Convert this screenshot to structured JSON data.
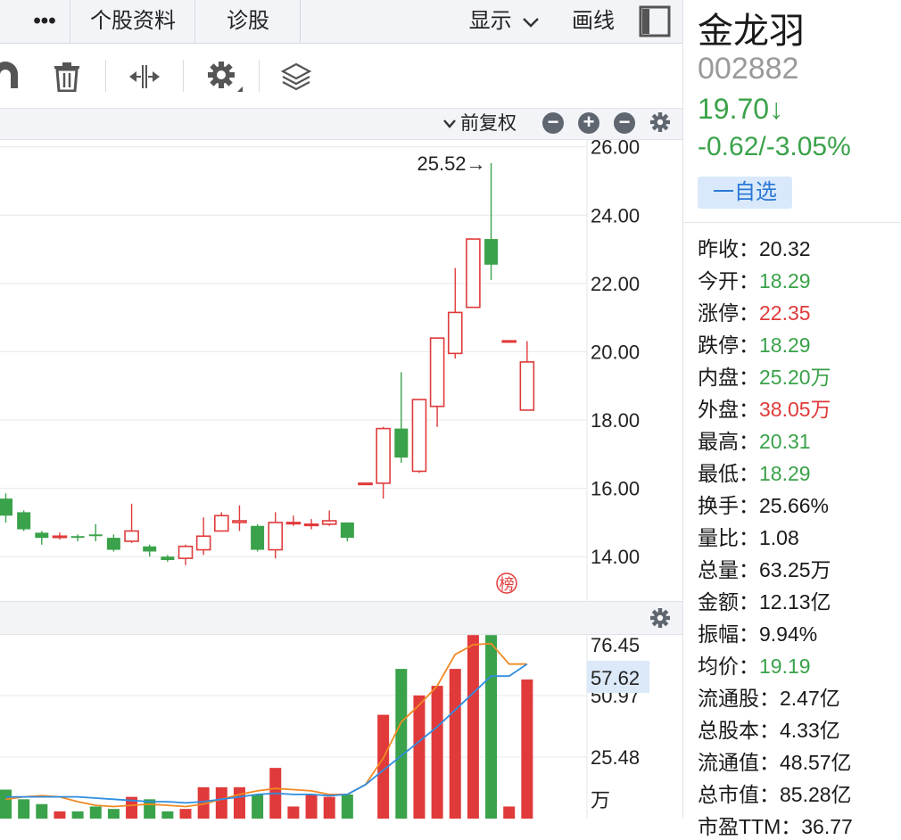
{
  "tabs": {
    "more_label": "•••",
    "profile_label": "个股资料",
    "diagnose_label": "诊股",
    "display_label": "显示",
    "draw_label": "画线"
  },
  "adjust": {
    "label": "前复权"
  },
  "stock": {
    "name": "金龙羽",
    "code": "002882",
    "price": "19.70↓",
    "change": "-0.62/-3.05%",
    "fav_label": "一自选"
  },
  "stats": [
    {
      "label": "昨收：",
      "value": "20.32",
      "color": "default"
    },
    {
      "label": "今开：",
      "value": "18.29",
      "color": "green"
    },
    {
      "label": "涨停：",
      "value": "22.35",
      "color": "red"
    },
    {
      "label": "跌停：",
      "value": "18.29",
      "color": "green"
    },
    {
      "label": "内盘：",
      "value": "25.20万",
      "color": "green"
    },
    {
      "label": "外盘：",
      "value": "38.05万",
      "color": "red"
    },
    {
      "label": "最高：",
      "value": "20.31",
      "color": "green"
    },
    {
      "label": "最低：",
      "value": "18.29",
      "color": "green"
    },
    {
      "label": "换手：",
      "value": "25.66%",
      "color": "default"
    },
    {
      "label": "量比：",
      "value": "1.08",
      "color": "default"
    },
    {
      "label": "总量：",
      "value": "63.25万",
      "color": "default"
    },
    {
      "label": "金额：",
      "value": "12.13亿",
      "color": "default"
    },
    {
      "label": "振幅：",
      "value": "9.94%",
      "color": "default"
    },
    {
      "label": "均价：",
      "value": "19.19",
      "color": "green"
    },
    {
      "label": "流通股：",
      "value": "2.47亿",
      "color": "default"
    },
    {
      "label": "总股本：",
      "value": "4.33亿",
      "color": "default"
    },
    {
      "label": "流通值：",
      "value": "48.57亿",
      "color": "default"
    },
    {
      "label": "总市值：",
      "value": "85.28亿",
      "color": "default"
    },
    {
      "label": "市盈TTM：",
      "value": "36.77",
      "color": "default"
    }
  ],
  "colors": {
    "up": "#e03a3a",
    "down": "#3aa24a",
    "ma_short": "#f08a24",
    "ma_long": "#2e8de0",
    "grid": "#e8e8e8",
    "panel_bg": "#f2f4f7"
  },
  "chart_data": [
    {
      "type": "candlestick",
      "yaxis": {
        "ticks": [
          "26.00",
          "24.00",
          "22.00",
          "20.00",
          "18.00",
          "16.00",
          "14.00"
        ],
        "ylim": [
          12.7,
          26.2
        ]
      },
      "max_annotation": "25.52→",
      "marker_text": "榜",
      "candles": [
        {
          "o": 15.7,
          "c": 15.2,
          "h": 15.85,
          "l": 15.0
        },
        {
          "o": 15.3,
          "c": 14.8,
          "h": 15.35,
          "l": 14.75
        },
        {
          "o": 14.7,
          "c": 14.55,
          "h": 14.75,
          "l": 14.35
        },
        {
          "o": 14.6,
          "c": 14.6,
          "h": 14.7,
          "l": 14.5
        },
        {
          "o": 14.6,
          "c": 14.55,
          "h": 14.65,
          "l": 14.45
        },
        {
          "o": 14.65,
          "c": 14.6,
          "h": 14.95,
          "l": 14.45
        },
        {
          "o": 14.55,
          "c": 14.2,
          "h": 14.65,
          "l": 14.15
        },
        {
          "o": 14.45,
          "c": 14.75,
          "h": 15.55,
          "l": 14.4
        },
        {
          "o": 14.3,
          "c": 14.15,
          "h": 14.35,
          "l": 14.0
        },
        {
          "o": 14.0,
          "c": 13.9,
          "h": 14.05,
          "l": 13.85
        },
        {
          "o": 13.95,
          "c": 14.3,
          "h": 14.35,
          "l": 13.75
        },
        {
          "o": 14.2,
          "c": 14.6,
          "h": 15.15,
          "l": 14.05
        },
        {
          "o": 14.75,
          "c": 15.2,
          "h": 15.3,
          "l": 14.75
        },
        {
          "o": 15.0,
          "c": 15.05,
          "h": 15.5,
          "l": 14.75
        },
        {
          "o": 14.9,
          "c": 14.2,
          "h": 14.95,
          "l": 14.15
        },
        {
          "o": 14.2,
          "c": 15.0,
          "h": 15.3,
          "l": 13.95
        },
        {
          "o": 15.0,
          "c": 15.0,
          "h": 15.2,
          "l": 14.9
        },
        {
          "o": 14.95,
          "c": 14.95,
          "h": 15.1,
          "l": 14.8
        },
        {
          "o": 14.95,
          "c": 15.05,
          "h": 15.35,
          "l": 14.9
        },
        {
          "o": 15.0,
          "c": 14.55,
          "h": 15.0,
          "l": 14.45
        },
        {
          "o": 16.15,
          "c": 16.15,
          "h": 16.15,
          "l": 16.15
        },
        {
          "o": 16.15,
          "c": 17.75,
          "h": 17.8,
          "l": 15.7
        },
        {
          "o": 17.75,
          "c": 16.9,
          "h": 19.4,
          "l": 16.75
        },
        {
          "o": 16.5,
          "c": 18.6,
          "h": 18.6,
          "l": 16.45
        },
        {
          "o": 18.4,
          "c": 20.4,
          "h": 20.4,
          "l": 17.8
        },
        {
          "o": 19.95,
          "c": 21.15,
          "h": 22.45,
          "l": 19.8
        },
        {
          "o": 21.3,
          "c": 23.3,
          "h": 23.3,
          "l": 21.3
        },
        {
          "o": 23.3,
          "c": 22.55,
          "h": 25.52,
          "l": 22.1
        },
        {
          "o": 20.32,
          "c": 20.32,
          "h": 20.32,
          "l": 20.32
        },
        {
          "o": 18.29,
          "c": 19.7,
          "h": 20.31,
          "l": 18.29
        }
      ]
    },
    {
      "type": "bar",
      "series_name": "volume",
      "yaxis": {
        "ticks": [
          "76.45",
          "50.97",
          "25.48"
        ],
        "ylim": [
          0,
          76.45
        ]
      },
      "current_value_label": "57.62",
      "unit": "万",
      "values": [
        12,
        8,
        6,
        3,
        3,
        5,
        4,
        9,
        8,
        3,
        4,
        13,
        13,
        13,
        10,
        21,
        5,
        10,
        9,
        10,
        0,
        43,
        62,
        51,
        55,
        62,
        76,
        76,
        5,
        57.62
      ],
      "ma_short": [
        8,
        9,
        9.5,
        9,
        7,
        5.5,
        5,
        5.5,
        6,
        5.5,
        5,
        6,
        8,
        10,
        11.5,
        12.5,
        12,
        11.5,
        10,
        10,
        14,
        25,
        40,
        47,
        55,
        68,
        72,
        72.5,
        64,
        64
      ],
      "ma_long": [
        9,
        9,
        9,
        9,
        9,
        8.5,
        8,
        7.5,
        7,
        7,
        6.5,
        7,
        8,
        9,
        10,
        10.5,
        10,
        10,
        9.5,
        10,
        14,
        20,
        26,
        32,
        38,
        45,
        52,
        59,
        59,
        64
      ]
    }
  ]
}
